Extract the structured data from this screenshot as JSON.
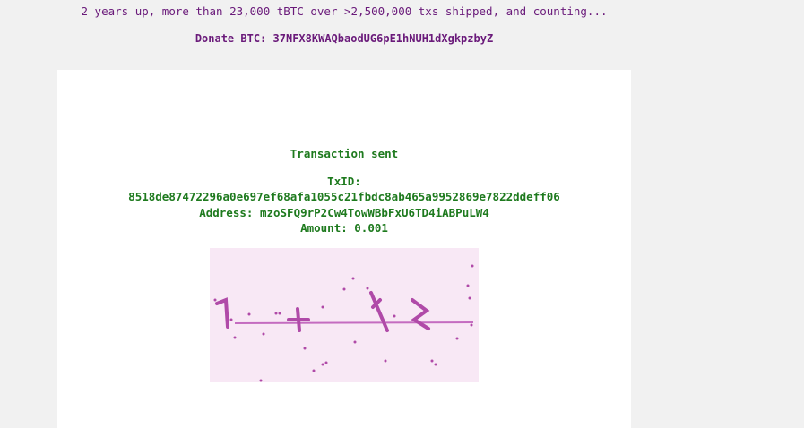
{
  "header": {
    "stats_text": "2 years up, more than 23,000 tBTC over >2,500,000 txs shipped, and counting...",
    "donate_label": "Donate BTC:",
    "donate_address": "37NFX8KWAQbaodUG6pE1hNUH1dXgkpzbyZ"
  },
  "result": {
    "title": "Transaction sent",
    "txid_label": "TxID:",
    "txid": "8518de87472296a0e697ef68afa1055c21fbdc8ab465a9952869e7822ddeff06",
    "address_label": "Address:",
    "address": "mzoSFQ9rP2Cw4TowWBbFxU6TD4iABPuLW4",
    "amount_label": "Amount:",
    "amount": "0.001"
  },
  "captcha": {
    "colors": {
      "background": "#f8e8f5",
      "ink": "#b04aa8",
      "line": "#c46cc0"
    }
  }
}
